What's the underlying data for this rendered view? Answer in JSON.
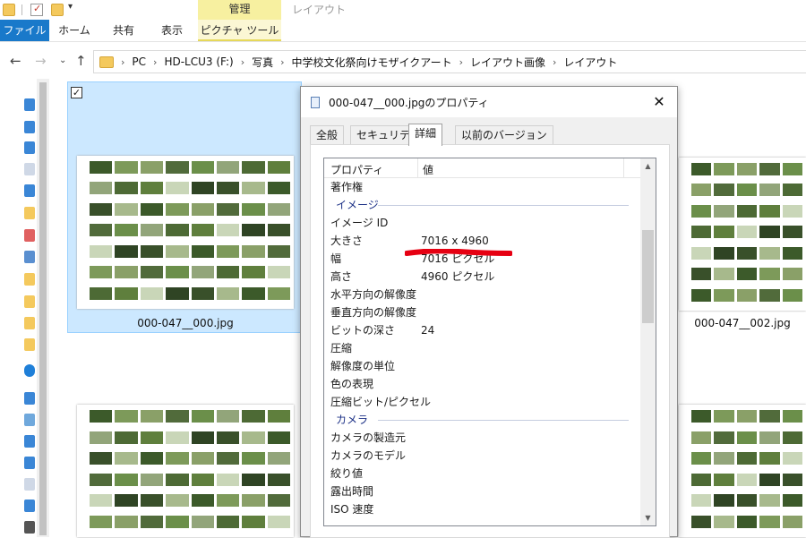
{
  "titlebar": {
    "contextual_tab_manage": "管理",
    "contextual_tab_layout": "レイアウト"
  },
  "ribbon": {
    "tabs": [
      {
        "label": "ファイル"
      },
      {
        "label": "ホーム"
      },
      {
        "label": "共有"
      },
      {
        "label": "表示"
      },
      {
        "label": "ピクチャ ツール"
      }
    ]
  },
  "address": {
    "crumbs": [
      "PC",
      "HD-LCU3 (F:)",
      "写真",
      "中学校文化祭向けモザイクアート",
      "レイアウト画像",
      "レイアウト"
    ]
  },
  "files": [
    {
      "name": "000-047__000.jpg",
      "selected": true
    },
    {
      "name": "000-047__002.jpg",
      "selected": false
    }
  ],
  "dialog": {
    "title": "000-047__000.jpgのプロパティ",
    "tabs": [
      "全般",
      "セキュリティ",
      "詳細",
      "以前のバージョン"
    ],
    "active_tab": "詳細",
    "columns": {
      "property": "プロパティ",
      "value": "値"
    },
    "rows": [
      {
        "k": "著作権",
        "v": ""
      },
      {
        "group": "イメージ"
      },
      {
        "k": "イメージ ID",
        "v": ""
      },
      {
        "k": "大きさ",
        "v": "7016 x 4960"
      },
      {
        "k": "幅",
        "v": "7016 ピクセル"
      },
      {
        "k": "高さ",
        "v": "4960 ピクセル"
      },
      {
        "k": "水平方向の解像度",
        "v": ""
      },
      {
        "k": "垂直方向の解像度",
        "v": ""
      },
      {
        "k": "ビットの深さ",
        "v": "24"
      },
      {
        "k": "圧縮",
        "v": ""
      },
      {
        "k": "解像度の単位",
        "v": ""
      },
      {
        "k": "色の表現",
        "v": ""
      },
      {
        "k": "圧縮ビット/ピクセル",
        "v": ""
      },
      {
        "group": "カメラ"
      },
      {
        "k": "カメラの製造元",
        "v": ""
      },
      {
        "k": "カメラのモデル",
        "v": ""
      },
      {
        "k": "絞り値",
        "v": ""
      },
      {
        "k": "露出時間",
        "v": ""
      },
      {
        "k": "ISO 速度",
        "v": ""
      }
    ]
  },
  "colors": {
    "file_tab": "#1979ca",
    "selection": "#cce8ff",
    "annotation": "#e60012",
    "group_header": "#1e3287"
  }
}
